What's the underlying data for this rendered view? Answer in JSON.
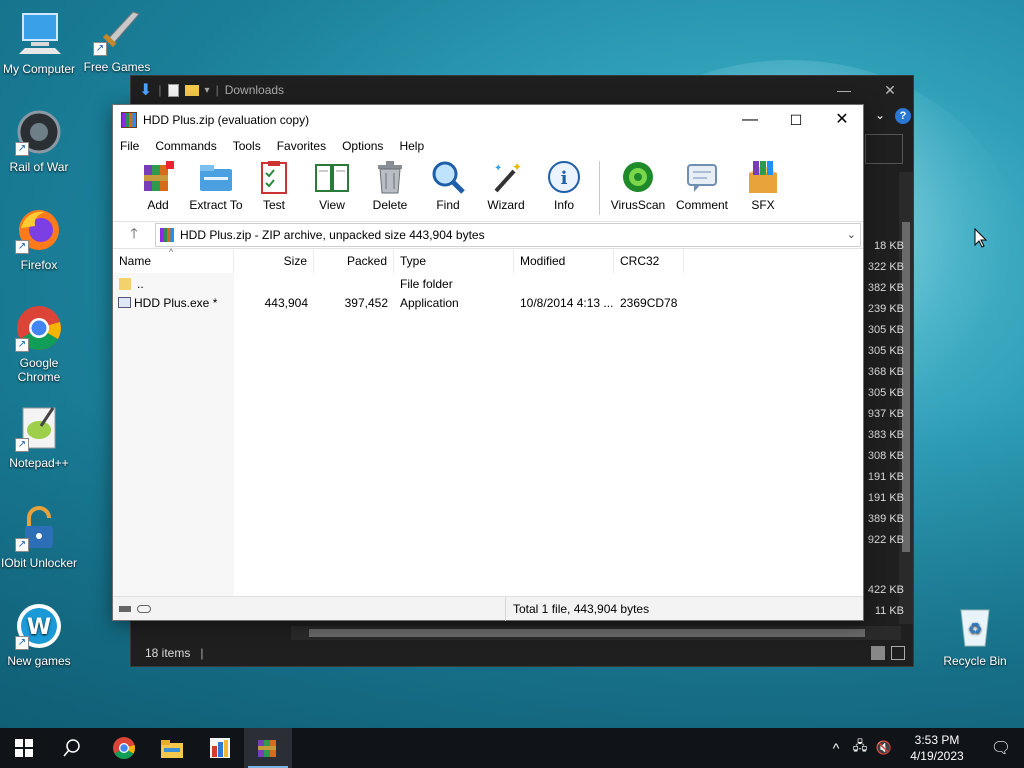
{
  "desktop": {
    "icons": [
      {
        "label": "My Computer"
      },
      {
        "label": "Free Games"
      },
      {
        "label": "Rail of War"
      },
      {
        "label": "Firefox"
      },
      {
        "label": "Google Chrome"
      },
      {
        "label": "Notepad++"
      },
      {
        "label": "IObit Unlocker"
      },
      {
        "label": "New games"
      },
      {
        "label": "Recycle Bin"
      }
    ]
  },
  "explorer": {
    "title": "Downloads",
    "sizes": [
      "18 KB",
      "322 KB",
      "382 KB",
      "239 KB",
      "305 KB",
      "305 KB",
      "368 KB",
      "305 KB",
      "937 KB",
      "383 KB",
      "308 KB",
      "191 KB",
      "191 KB",
      "389 KB",
      "922 KB"
    ],
    "sizes_bottom": [
      "422 KB",
      "11 KB"
    ],
    "status_items": "18 items"
  },
  "winrar": {
    "title": "HDD Plus.zip (evaluation copy)",
    "menu": [
      "File",
      "Commands",
      "Tools",
      "Favorites",
      "Options",
      "Help"
    ],
    "tools": [
      {
        "label": "Add",
        "icon": "add-icon"
      },
      {
        "label": "Extract To",
        "icon": "extract-icon"
      },
      {
        "label": "Test",
        "icon": "test-icon"
      },
      {
        "label": "View",
        "icon": "view-icon"
      },
      {
        "label": "Delete",
        "icon": "delete-icon"
      },
      {
        "label": "Find",
        "icon": "find-icon"
      },
      {
        "label": "Wizard",
        "icon": "wizard-icon"
      },
      {
        "label": "Info",
        "icon": "info-icon"
      },
      {
        "label": "VirusScan",
        "icon": "virusscan-icon"
      },
      {
        "label": "Comment",
        "icon": "comment-icon"
      },
      {
        "label": "SFX",
        "icon": "sfx-icon"
      }
    ],
    "path": "HDD Plus.zip - ZIP archive, unpacked size 443,904 bytes",
    "columns": [
      "Name",
      "Size",
      "Packed",
      "Type",
      "Modified",
      "CRC32"
    ],
    "rows": [
      {
        "name": "..",
        "size": "",
        "packed": "",
        "type": "File folder",
        "modified": "",
        "crc": ""
      },
      {
        "name": "HDD Plus.exe *",
        "size": "443,904",
        "packed": "397,452",
        "type": "Application",
        "modified": "10/8/2014 4:13 ...",
        "crc": "2369CD78"
      }
    ],
    "status": "Total 1 file, 443,904 bytes"
  },
  "taskbar": {
    "time": "3:53 PM",
    "date": "4/19/2023"
  }
}
